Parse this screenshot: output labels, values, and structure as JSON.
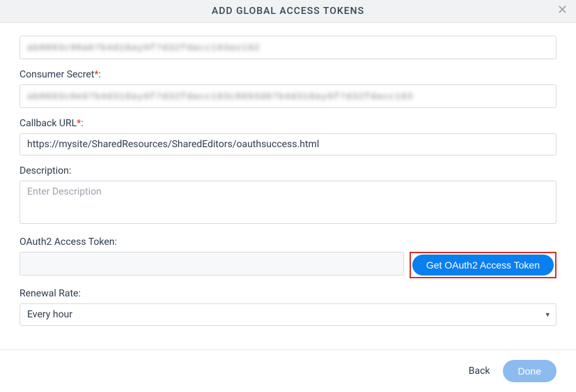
{
  "dialog": {
    "title": "ADD GLOBAL ACCESS TOKENS"
  },
  "fields": {
    "consumer_key": {
      "masked_value": "ab0093c90a67b4d18ay9f7d32fdacc193av192"
    },
    "consumer_secret": {
      "label": "Consumer Secret",
      "colon": ":",
      "masked_value": "ab0093c0e67b4d318ay9f7d32fdacc193c0093d67b4d318ay9f7d32fdacc193"
    },
    "callback_url": {
      "label": "Callback URL",
      "colon": ":",
      "value": "https://mysite/SharedResources/SharedEditors/oauthsuccess.html"
    },
    "description": {
      "label": "Description:",
      "placeholder": "Enter Description",
      "value": ""
    },
    "oauth_token": {
      "label": "OAuth2 Access Token:",
      "value": "",
      "button_label": "Get OAuth2 Access Token"
    },
    "renewal_rate": {
      "label": "Renewal Rate:",
      "selected": "Every hour"
    }
  },
  "footer": {
    "back_label": "Back",
    "done_label": "Done"
  }
}
